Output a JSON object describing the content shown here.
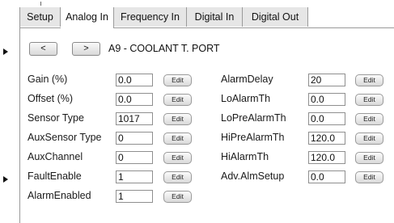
{
  "tabs": [
    "Setup",
    "Analog In",
    "Frequency In",
    "Digital In",
    "Digital Out"
  ],
  "nav": {
    "prev": "<",
    "next": ">",
    "channel_title": "A9 - COOLANT T. PORT"
  },
  "edit_label": "Edit",
  "left_fields": [
    {
      "label": "Gain (%)",
      "value": "0.0"
    },
    {
      "label": "Offset (%)",
      "value": "0.0"
    },
    {
      "label": "Sensor Type",
      "value": "1017"
    },
    {
      "label": "AuxSensor Type",
      "value": "0"
    },
    {
      "label": "AuxChannel",
      "value": "0"
    },
    {
      "label": "FaultEnable",
      "value": "1"
    },
    {
      "label": "AlarmEnabled",
      "value": "1"
    }
  ],
  "right_fields": [
    {
      "label": "AlarmDelay",
      "value": "20"
    },
    {
      "label": "LoAlarmTh",
      "value": "0.0"
    },
    {
      "label": "LoPreAlarmTh",
      "value": "0.0"
    },
    {
      "label": "HiPreAlarmTh",
      "value": "120.0"
    },
    {
      "label": "HiAlarmTh",
      "value": "120.0"
    },
    {
      "label": "Adv.AlmSetup",
      "value": "0.0"
    }
  ]
}
